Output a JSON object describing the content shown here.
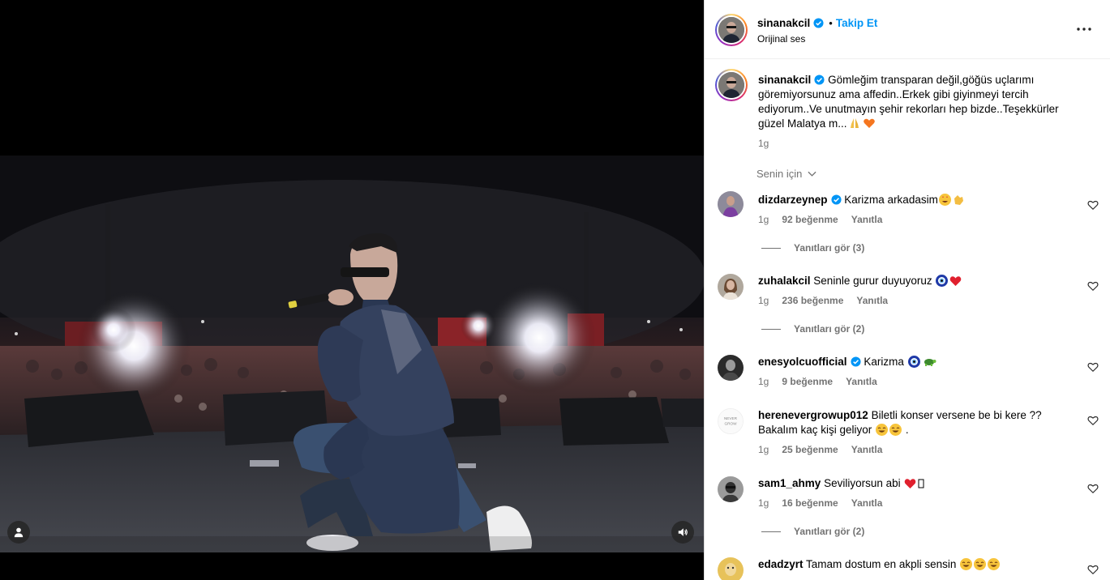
{
  "post": {
    "username": "sinanakcil",
    "follow_label": "Takip Et",
    "dot": "•",
    "audio": "Orijinal ses",
    "caption": "Gömleğim transparan değil,göğüs uçlarımı göremiyorsunuz ama affedin..Erkek gibi giyinmeyi tercih ediyorum..Ve unutmayın şehir rekorları hep bizde..Teşekkürler güzel Malatya m...",
    "time": "1g",
    "sort_label": "Senin için"
  },
  "comments": [
    {
      "user": "dizdarzeynep",
      "verified": true,
      "text": "Karizma arkadasim",
      "emojis": [
        "star-struck",
        "clap"
      ],
      "time": "1g",
      "likes": "92 beğenme",
      "reply": "Yanıtla",
      "replies": "Yanıtları gör (3)"
    },
    {
      "user": "zuhalakcil",
      "verified": false,
      "text": "Seninle gurur duyuyoruz ",
      "emojis": [
        "nazar",
        "red-heart"
      ],
      "time": "1g",
      "likes": "236 beğenme",
      "reply": "Yanıtla",
      "replies": "Yanıtları gör (2)"
    },
    {
      "user": "enesyolcuofficial",
      "verified": true,
      "text": "Karizma ",
      "emojis": [
        "nazar",
        "turtle"
      ],
      "time": "1g",
      "likes": "9 beğenme",
      "reply": "Yanıtla",
      "replies": ""
    },
    {
      "user": "herenevergrowup012",
      "verified": false,
      "text": "Biletli konser versene be bi kere ?? Bakalım kaç kişi geliyor",
      "emojis": [
        "joy",
        "joy"
      ],
      "text_suffix": " .",
      "time": "1g",
      "likes": "25 beğenme",
      "reply": "Yanıtla",
      "replies": ""
    },
    {
      "user": "sam1_ahmy",
      "verified": false,
      "text": "Seviliyorsun abi ",
      "emojis": [
        "red-heart",
        "box"
      ],
      "time": "1g",
      "likes": "16 beğenme",
      "reply": "Yanıtla",
      "replies": "Yanıtları gör (2)"
    },
    {
      "user": "edadzyrt",
      "verified": false,
      "text": "Tamam dostum en akpli sensin ",
      "emojis": [
        "joy",
        "joy",
        "joy"
      ],
      "time": "",
      "likes": "",
      "reply": "",
      "replies": ""
    }
  ],
  "colors": {
    "accent": "#0095f6",
    "muted": "#737373",
    "verified": "#0095f6"
  }
}
